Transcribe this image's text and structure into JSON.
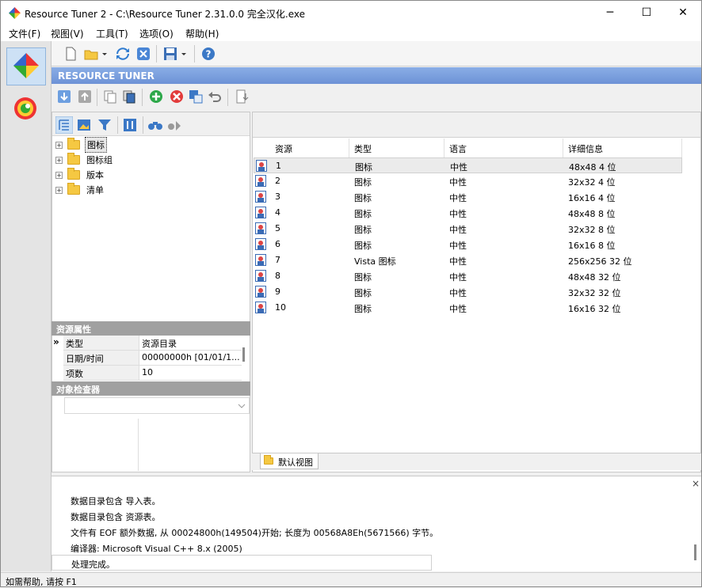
{
  "window": {
    "title": "Resource Tuner 2 - C:\\Resource Tuner 2.31.0.0 完全汉化.exe",
    "minimize": "─",
    "maximize": "☐",
    "close": "✕"
  },
  "menu": [
    "文件(F)",
    "视图(V)",
    "工具(T)",
    "选项(O)",
    "帮助(H)"
  ],
  "header": {
    "title": "RESOURCE TUNER"
  },
  "tree": {
    "items": [
      {
        "label": "图标",
        "selected": true
      },
      {
        "label": "图标组"
      },
      {
        "label": "版本"
      },
      {
        "label": "清单"
      }
    ]
  },
  "properties": {
    "section_title": "资源属性",
    "marker": "»",
    "rows": [
      {
        "key": "类型",
        "value": "资源目录"
      },
      {
        "key": "日期/时间",
        "value": "00000000h  [01/01/1..."
      },
      {
        "key": "项数",
        "value": "10"
      }
    ]
  },
  "inspector": {
    "section_title": "对象检查器"
  },
  "list": {
    "columns": [
      "资源",
      "类型",
      "语言",
      "详细信息"
    ],
    "rows": [
      {
        "id": "1",
        "type": "图标",
        "lang": "中性",
        "detail": "48x48 4 位"
      },
      {
        "id": "2",
        "type": "图标",
        "lang": "中性",
        "detail": "32x32 4 位"
      },
      {
        "id": "3",
        "type": "图标",
        "lang": "中性",
        "detail": "16x16 4 位"
      },
      {
        "id": "4",
        "type": "图标",
        "lang": "中性",
        "detail": "48x48 8 位"
      },
      {
        "id": "5",
        "type": "图标",
        "lang": "中性",
        "detail": "32x32 8 位"
      },
      {
        "id": "6",
        "type": "图标",
        "lang": "中性",
        "detail": "16x16 8 位"
      },
      {
        "id": "7",
        "type": "Vista 图标",
        "lang": "中性",
        "detail": "256x256 32 位"
      },
      {
        "id": "8",
        "type": "图标",
        "lang": "中性",
        "detail": "48x48 32 位"
      },
      {
        "id": "9",
        "type": "图标",
        "lang": "中性",
        "detail": "32x32 32 位"
      },
      {
        "id": "10",
        "type": "图标",
        "lang": "中性",
        "detail": "16x16 32 位"
      }
    ]
  },
  "tabs": {
    "default_view": "默认视图"
  },
  "log": {
    "close": "×",
    "lines": [
      "数据目录包含 导入表。",
      "数据目录包含 资源表。",
      "文件有 EOF 额外数据, 从 00024800h(149504)开始; 长度为 00568A8Eh(5671566) 字节。",
      "编译器: Microsoft Visual C++ 8.x (2005)"
    ],
    "last": "处理完成。"
  },
  "status": {
    "text": "如需帮助, 请按 F1"
  }
}
